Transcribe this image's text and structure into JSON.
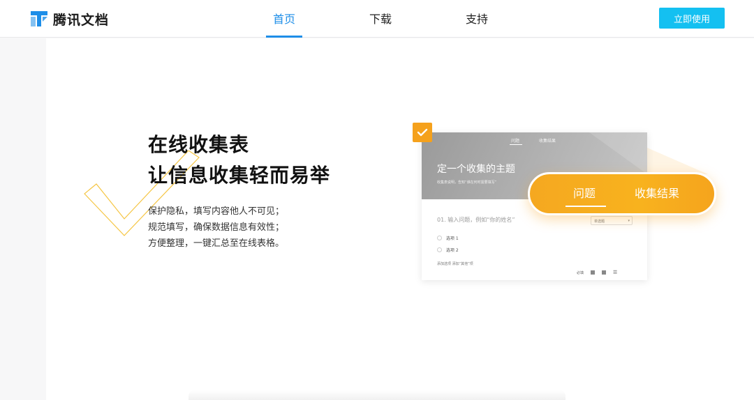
{
  "brand": {
    "name": "腾讯文档",
    "color": "#1e8ee8",
    "logo_icon": "tencent-docs-logo-icon"
  },
  "nav": {
    "items": [
      {
        "label": "首页",
        "active": true
      },
      {
        "label": "下载",
        "active": false
      },
      {
        "label": "支持",
        "active": false
      }
    ],
    "cta_label": "立即使用",
    "cta_color": "#14c0f1"
  },
  "hero": {
    "headline_line1": "在线收集表",
    "headline_line2": "让信息收集轻而易举",
    "desc_lines": [
      "保护隐私，填写内容他人不可见；",
      "规范填写，确保数据信息有效性；",
      "方便整理，一键汇总至在线表格。"
    ],
    "deco_icon": "checkmark-outline-icon",
    "accent_color": "#f5a11c"
  },
  "mock_form": {
    "tabs": [
      "问题",
      "收集结果"
    ],
    "title": "定一个收集的主题",
    "subtitle": "收集表说明，告知“谁在何时需要填写”",
    "question": "01.  输入问题，例如“你的姓名”",
    "type_select": "单选题",
    "options": [
      "选项 1",
      "选项 2"
    ],
    "add_option": "添加选项   添加“其他”项",
    "required_label": "必填",
    "badge_icon": "check-icon"
  },
  "pill": {
    "tabs": [
      "问题",
      "收集结果"
    ],
    "active_index": 0,
    "color": "#f5a820"
  }
}
